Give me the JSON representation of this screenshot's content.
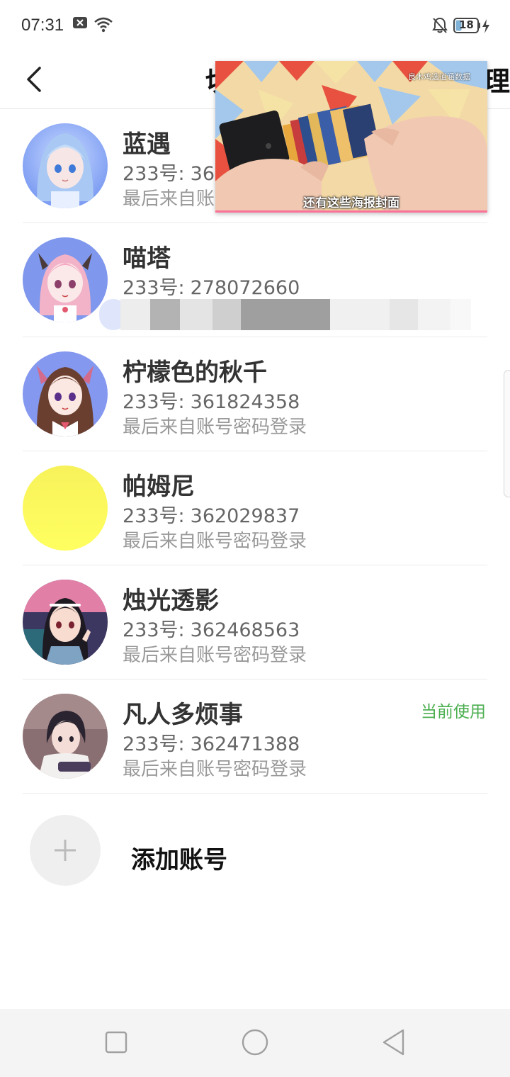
{
  "status_bar": {
    "time": "07:31",
    "battery_level": "18",
    "icons": [
      "close-box-icon",
      "wifi-icon",
      "bell-off-icon",
      "battery-icon",
      "charging-bolt-icon"
    ]
  },
  "header": {
    "back_icon": "chevron-left-icon",
    "title_left_fragment": "切",
    "title_right_fragment": "理"
  },
  "accounts": [
    {
      "name": "蓝遇",
      "id_prefix": "233号:",
      "id": "362",
      "login": "最后来自账",
      "current": false,
      "avatar": "anime-girl-blue-hair"
    },
    {
      "name": "喵塔",
      "id_prefix": "233号:",
      "id": "278072660",
      "login": "",
      "current": false,
      "avatar": "anime-girl-pink-hair"
    },
    {
      "name": "柠檬色的秋千",
      "id_prefix": "233号:",
      "id": "361824358",
      "login": "最后来自账号密码登录",
      "current": false,
      "avatar": "anime-girl-brown-hair"
    },
    {
      "name": "帕姆尼",
      "id_prefix": "233号:",
      "id": "362029837",
      "login": "最后来自账号密码登录",
      "current": false,
      "avatar": "yellow-gradient"
    },
    {
      "name": "烛光透影",
      "id_prefix": "233号:",
      "id": "362468563",
      "login": "最后来自账号密码登录",
      "current": false,
      "avatar": "anime-girl-black-hair"
    },
    {
      "name": "凡人多烦事",
      "id_prefix": "233号:",
      "id": "362471388",
      "login": "最后来自账号密码登录",
      "current": true,
      "current_label": "当前使用",
      "avatar": "anime-boy-dark-hair"
    }
  ],
  "add_account": {
    "label": "添加账号",
    "icon": "plus-icon"
  },
  "pip_video": {
    "subtitle": "还有这些海报封面",
    "channel_text": "良木鸡选道涵数据"
  },
  "nav_bar": {
    "icons": [
      "recent-apps-icon",
      "home-icon",
      "back-triangle-icon"
    ]
  },
  "colors": {
    "accent_green": "#4caf50",
    "divider": "#ececec",
    "nav_bg": "#f4f4f4"
  }
}
